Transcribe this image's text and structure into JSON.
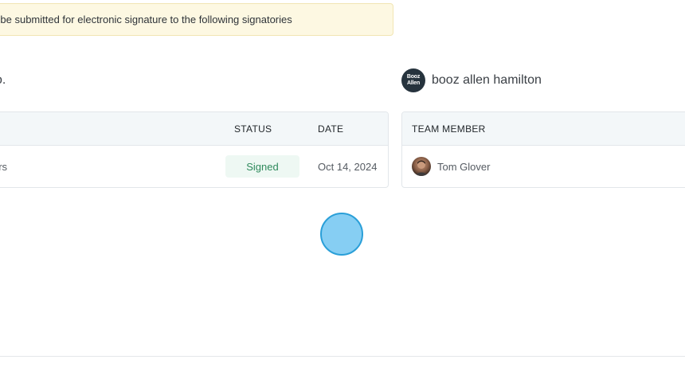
{
  "notice": {
    "text": "ll be submitted for electronic signature to the following signatories"
  },
  "left_party": {
    "name_fragment": "o."
  },
  "right_party": {
    "logo_line1": "Booz",
    "logo_line2": "Allen",
    "name": "booz allen hamilton"
  },
  "left_table": {
    "headers": {
      "status": "STATUS",
      "date": "DATE"
    },
    "rows": [
      {
        "name_fragment": "ers",
        "status": "Signed",
        "date": "Oct 14, 2024"
      }
    ],
    "colors": {
      "signed_text": "#2f8a5c",
      "signed_bg": "#eef8f3"
    }
  },
  "right_table": {
    "headers": {
      "team_member": "TEAM MEMBER"
    },
    "rows": [
      {
        "name": "Tom Glover"
      }
    ]
  },
  "colors": {
    "notice_bg": "#fdf8e2",
    "header_bg": "#f3f7f9",
    "cursor_fill": "#86cef3",
    "cursor_border": "#2a9fd8"
  }
}
